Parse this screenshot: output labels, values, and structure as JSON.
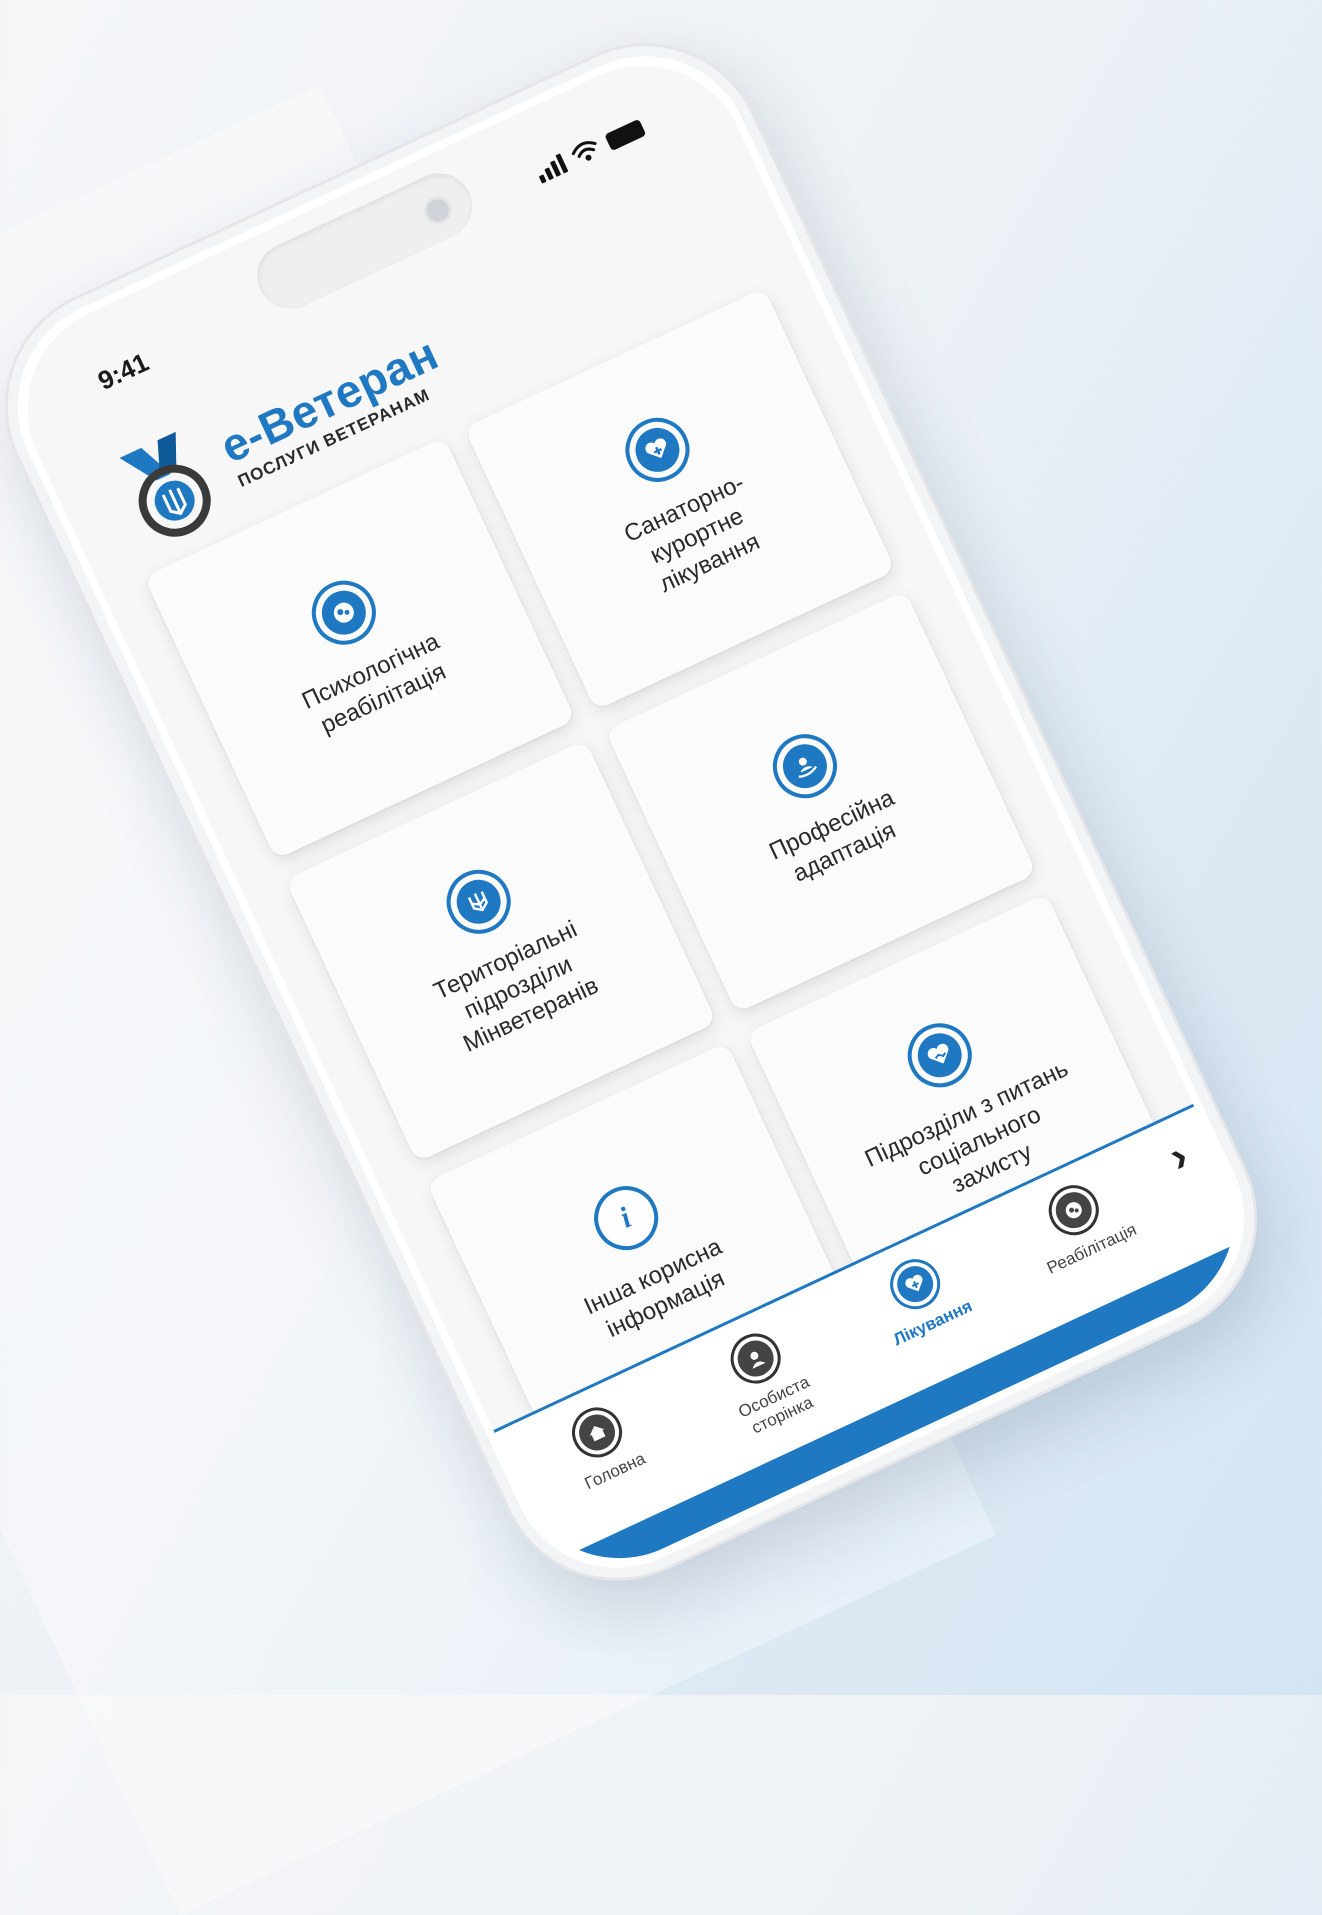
{
  "status_bar": {
    "time": "9:41"
  },
  "brand": {
    "title": "e-Ветеран",
    "subtitle": "ПОСЛУГИ ВЕТЕРАНАМ"
  },
  "tiles": [
    {
      "label": "Психологічна\nреабілітація",
      "icon": "brain-gears-icon"
    },
    {
      "label": "Санаторно-\nкурортне\nлікування",
      "icon": "heart-plus-icon"
    },
    {
      "label": "Територіальні\nпідрозділи\nМінветеранів",
      "icon": "trident-icon"
    },
    {
      "label": "Професійна\nадаптація",
      "icon": "hand-person-icon"
    },
    {
      "label": "Інша корисна\nінформація",
      "icon": "info-icon"
    },
    {
      "label": "Підрозділи з питань\nсоціального\nзахисту",
      "icon": "heart-handshake-icon"
    }
  ],
  "tabbar": {
    "items": [
      {
        "label": "Головна",
        "icon": "home-icon",
        "active": false
      },
      {
        "label": "Особиста\nсторінка",
        "icon": "user-icon",
        "active": false
      },
      {
        "label": "Лікування",
        "icon": "heart-plus-icon",
        "active": true
      },
      {
        "label": "Реабілітація",
        "icon": "brain-icon",
        "active": false
      }
    ],
    "next": "›"
  },
  "colors": {
    "accent": "#1f78c2",
    "text": "#2a2a2a",
    "background": "#f7f7f7"
  }
}
